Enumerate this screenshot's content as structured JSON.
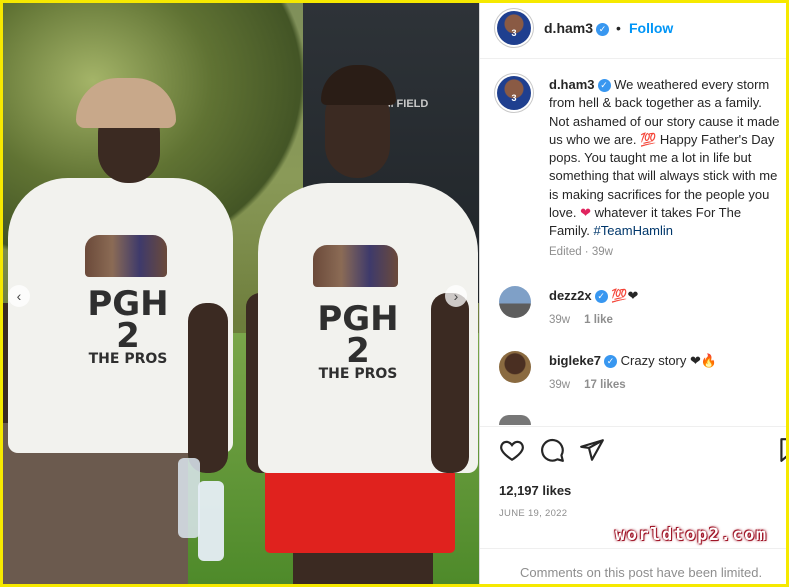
{
  "post": {
    "username": "d.ham3",
    "avatar_number": "3",
    "follow_label": "Follow",
    "dot": "•",
    "caption_text": "We weathered every storm from hell & back together as a family. Not ashamed of our story cause it made us who we are. 💯 Happy Father's Day pops. You taught me a lot in life but something that will always stick with me is making sacrifices for the people you love.",
    "caption_heart": "❤",
    "caption_tail": " whatever it takes For The Family. ",
    "hashtag": "#TeamHamlin",
    "edited": "Edited · 39w",
    "likes": "12,197 likes",
    "date": "JUNE 19, 2022",
    "comments_limited": "Comments on this post have been limited."
  },
  "photo": {
    "shirt_print_main": "PGH 2",
    "shirt_print_sub": "THE PROS",
    "building_sign": "C GRAHAM FIELD",
    "prev_icon": "‹",
    "next_icon": "›"
  },
  "comments": [
    {
      "user": "dezz2x",
      "text": "💯❤",
      "age": "39w",
      "likes": "1 like"
    },
    {
      "user": "bigleke7",
      "text": "Crazy story ❤🔥",
      "age": "39w",
      "likes": "17 likes"
    }
  ],
  "icons": {
    "like": "heart-outline-icon",
    "comment": "comment-icon",
    "share": "paper-plane-icon",
    "save": "bookmark-icon"
  },
  "watermark": "worldtop2.com",
  "colors": {
    "accent": "#0095f6",
    "verified": "#3897f0",
    "frame": "#f6e900",
    "heart": "#e0245e"
  }
}
